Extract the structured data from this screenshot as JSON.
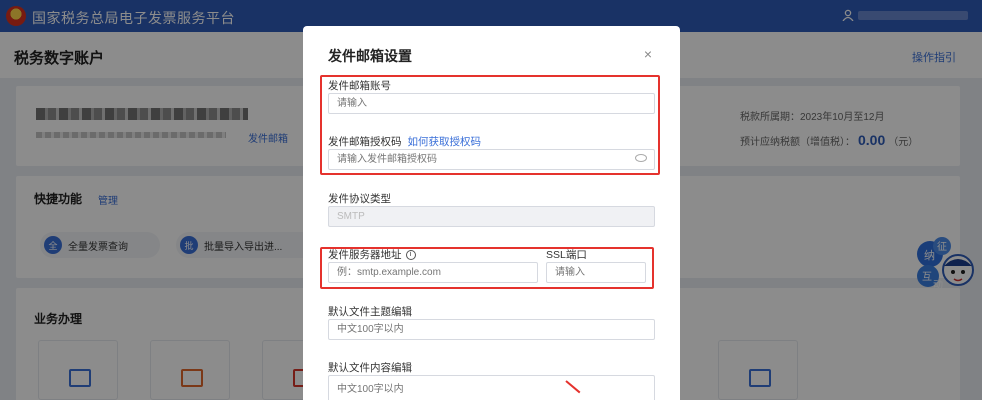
{
  "topbar": {
    "title": "国家税务总局电子发票服务平台"
  },
  "subheader": {
    "title": "税务数字账户",
    "guide": "操作指引"
  },
  "account": {
    "mail_settings_link": "发件邮箱",
    "tax_period": "税款所属期：2023年10月至12月",
    "est_tax_label": "预计应纳税额（增值税）：",
    "est_tax_amount": "0.00",
    "est_tax_unit": "（元）"
  },
  "quick": {
    "title": "快捷功能",
    "manage": "管理",
    "items": [
      {
        "icon": "全",
        "label": "全量发票查询"
      },
      {
        "icon": "批",
        "label": "批量导入导出进..."
      }
    ]
  },
  "business": {
    "title": "业务办理"
  },
  "mascot": {
    "text": "纳 征 互 动"
  },
  "modal": {
    "title": "发件邮箱设置",
    "close": "×",
    "account_label": "发件邮箱账号",
    "account_placeholder": "请输入",
    "auth_label": "发件邮箱授权码",
    "auth_link": "如何获取授权码",
    "auth_placeholder": "请输入发件邮箱授权码",
    "protocol_label": "发件协议类型",
    "protocol_value": "SMTP",
    "server_label": "发件服务器地址",
    "server_placeholder": "例：smtp.example.com",
    "ssl_label": "SSL端口",
    "ssl_placeholder": "请输入",
    "subject_label": "默认文件主题编辑",
    "subject_placeholder": "中文100字以内",
    "content_label": "默认文件内容编辑",
    "content_placeholder": "中文100字以内"
  },
  "colors": {
    "brand": "#2f5cb8",
    "link": "#3a6fd8",
    "highlight": "#e5322d"
  }
}
